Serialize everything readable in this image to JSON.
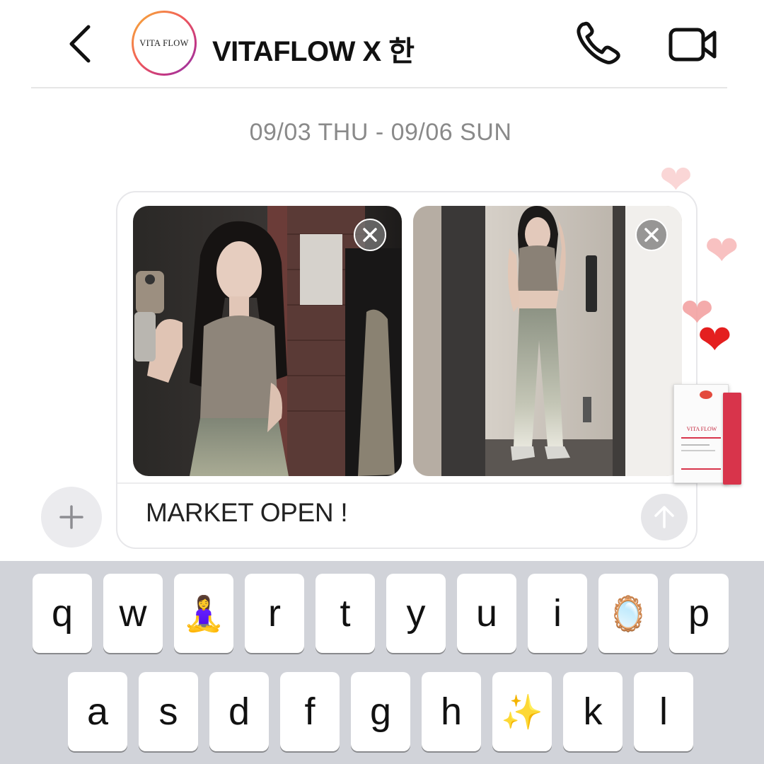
{
  "header": {
    "back_icon": "chevron-left-icon",
    "avatar_text": "VITA FLOW",
    "title": "VITAFLOW X 한",
    "call_icon": "phone-icon",
    "video_icon": "video-camera-icon"
  },
  "date_range": "09/03 THU - 09/06 SUN",
  "composer": {
    "attachments": [
      {
        "name": "mirror-selfie-photo",
        "remove_icon": "close-icon"
      },
      {
        "name": "full-body-mirror-photo",
        "remove_icon": "close-icon"
      }
    ],
    "message_text": "MARKET OPEN !",
    "send_icon": "arrow-up-icon",
    "plus_icon": "plus-icon"
  },
  "stickers": {
    "hearts": [
      "❤",
      "❤",
      "❤",
      "❤"
    ],
    "heart_colors": [
      "#f9c6c6",
      "#f7b7b7",
      "#f3a3a3",
      "#e41f1f"
    ],
    "product_brand": "VITA FLOW"
  },
  "keyboard": {
    "row1": [
      "q",
      "w",
      "🧘‍♀️",
      "r",
      "t",
      "y",
      "u",
      "i",
      "🪞",
      "p"
    ],
    "row2": [
      "a",
      "s",
      "d",
      "f",
      "g",
      "h",
      "✨",
      "k",
      "l"
    ]
  },
  "colors": {
    "accent_gradient": [
      "#f7b733",
      "#f15a5a",
      "#c13584",
      "#833ab4"
    ],
    "keyboard_bg": "#d1d3d9",
    "heart_red": "#e41f1f"
  }
}
